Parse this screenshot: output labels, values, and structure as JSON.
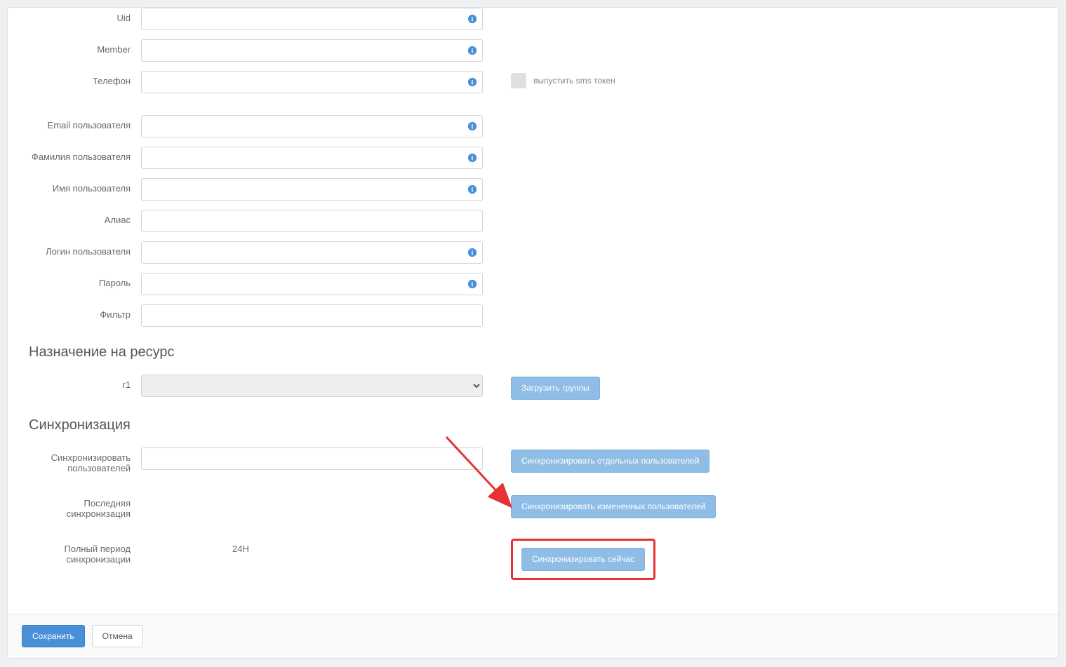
{
  "fields": {
    "uid": {
      "label": "Uid",
      "value": "",
      "hasInfo": true
    },
    "member": {
      "label": "Member",
      "value": "",
      "hasInfo": true
    },
    "phone": {
      "label": "Телефон",
      "value": "",
      "hasInfo": true
    },
    "email": {
      "label": "Email пользователя",
      "value": "",
      "hasInfo": true
    },
    "lastname": {
      "label": "Фамилия пользователя",
      "value": "",
      "hasInfo": true
    },
    "firstname": {
      "label": "Имя пользователя",
      "value": "",
      "hasInfo": true
    },
    "alias": {
      "label": "Алиас",
      "value": "",
      "hasInfo": false
    },
    "login": {
      "label": "Логин пользователя",
      "value": "",
      "hasInfo": true
    },
    "password": {
      "label": "Пароль",
      "value": "",
      "hasInfo": true
    },
    "filter": {
      "label": "Фильтр",
      "value": "",
      "hasInfo": false
    }
  },
  "smsToken": {
    "label": "выпустить sms токен"
  },
  "resourceSection": {
    "heading": "Назначение на ресурс",
    "r1Label": "r1",
    "loadGroupsBtn": "Загрузить группы"
  },
  "syncSection": {
    "heading": "Синхронизация",
    "syncUsersLabel": "Синхронизировать пользователей",
    "syncIndividualBtn": "Синхронизировать отдельных пользователей",
    "lastSyncLabel": "Последняя синхронизация",
    "syncChangedBtn": "Синхронизировать измененных пользователей",
    "fullPeriodLabel": "Полный период синхронизации",
    "fullPeriodValue": "24H",
    "syncNowBtn": "Синхронизировать сейчас"
  },
  "footer": {
    "saveBtn": "Сохранить",
    "cancelBtn": "Отмена"
  }
}
